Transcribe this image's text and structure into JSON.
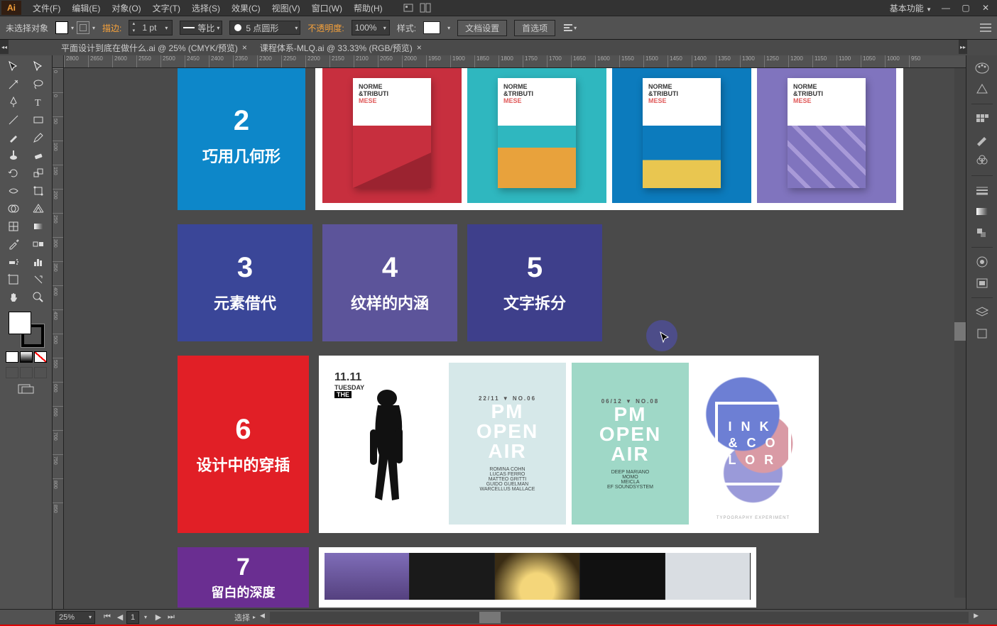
{
  "menu": {
    "logo": "Ai",
    "items": [
      "文件(F)",
      "编辑(E)",
      "对象(O)",
      "文字(T)",
      "选择(S)",
      "效果(C)",
      "视图(V)",
      "窗口(W)",
      "帮助(H)"
    ],
    "basic_func": "基本功能"
  },
  "optionbar": {
    "no_selection": "未选择对象",
    "stroke_label": "描边:",
    "stroke_value": "1 pt",
    "uniform": "等比",
    "brush_label": "5 点圆形",
    "opacity_label": "不透明度:",
    "opacity_value": "100%",
    "style_label": "样式:",
    "doc_setup": "文档设置",
    "prefs": "首选项"
  },
  "tabs": [
    {
      "label": "平面设计到底在做什么.ai @ 25% (CMYK/预览)",
      "active": false
    },
    {
      "label": "课程体系-MLQ.ai @ 33.33% (RGB/预览)",
      "active": true
    }
  ],
  "ruler_h": [
    "2800",
    "2650",
    "2600",
    "2550",
    "2500",
    "2450",
    "2400",
    "2350",
    "2300",
    "2250",
    "2200",
    "2150",
    "2100",
    "2050",
    "2000",
    "1950",
    "1900",
    "1850",
    "1800",
    "1750",
    "1700",
    "1650",
    "1600",
    "1550",
    "1500",
    "1450",
    "1400",
    "1350",
    "1300",
    "1250",
    "1200",
    "1150",
    "1100",
    "1050",
    "1000",
    "950"
  ],
  "ruler_v": [
    "0",
    "0",
    "50",
    "100",
    "150",
    "200",
    "250",
    "300",
    "350",
    "400",
    "450",
    "500",
    "550",
    "600",
    "650",
    "700",
    "750",
    "800",
    "850"
  ],
  "cards": {
    "c2": {
      "num": "2",
      "title": "巧用几何形"
    },
    "c3": {
      "num": "3",
      "title": "元素借代"
    },
    "c4": {
      "num": "4",
      "title": "纹样的内涵"
    },
    "c5": {
      "num": "5",
      "title": "文字拆分"
    },
    "c6": {
      "num": "6",
      "title": "设计中的穿插"
    },
    "c7": {
      "num": "7",
      "title": "留白的深度"
    }
  },
  "norme": {
    "line1": "NORME",
    "line2": "&TRIBUTI",
    "line3": "MESE"
  },
  "posters": {
    "man": {
      "date": "11.11",
      "day": "TUESDAY",
      "sub": "THE"
    },
    "openA": {
      "date": "22/11 ▼ NO.06",
      "l1": "PM",
      "l2": "OPEN",
      "l3": "AIR",
      "credits": "ROMINA COHN\nLUCAS FERRO\nMATTEO GRITTI\nGUIDO GUELMAN\nWARCELLUS MALLACE"
    },
    "openB": {
      "date": "06/12 ▼ NO.08",
      "l1": "PM",
      "l2": "OPEN",
      "l3": "AIR",
      "credits": "DEEP MARIANO\nMOMO\nMEICLA\nEF SOUNDSYSTEM"
    },
    "ink": {
      "l1": "I N K",
      "l2": "& C O",
      "l3": "L O R",
      "foot": "TYPOGRAPHY EXPERIMENT"
    }
  },
  "statusbar": {
    "zoom": "25%",
    "artboard": "1",
    "tool": "选择"
  }
}
